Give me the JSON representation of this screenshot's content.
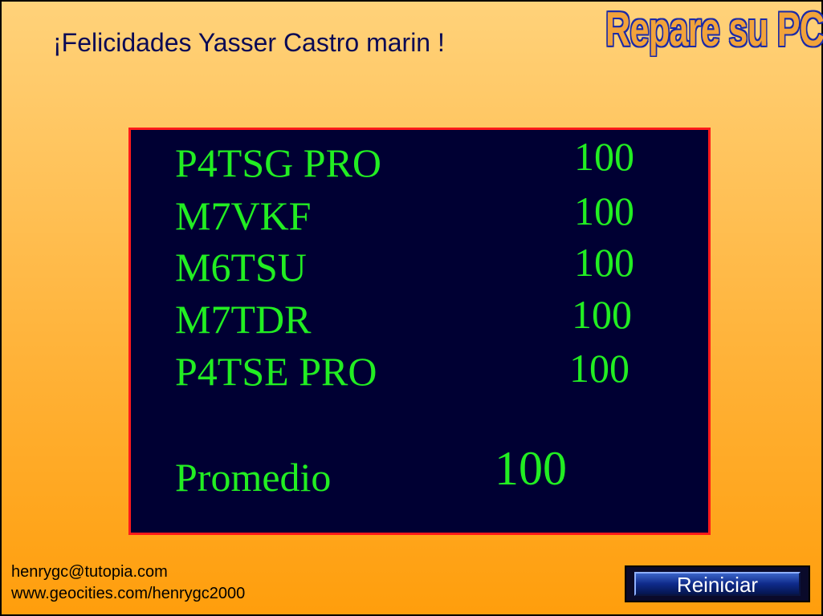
{
  "greeting": "¡Felicidades Yasser Castro marin !",
  "logo": "Repare su PC",
  "results": [
    {
      "label": "P4TSG PRO",
      "score": "100"
    },
    {
      "label": "M7VKF",
      "score": "100"
    },
    {
      "label": "M6TSU",
      "score": "100"
    },
    {
      "label": "M7TDR",
      "score": "100"
    },
    {
      "label": "P4TSE PRO",
      "score": "100"
    }
  ],
  "average": {
    "label": "Promedio",
    "score": "100"
  },
  "footer": {
    "email": "henrygc@tutopia.com",
    "website": "www.geocities.com/henrygc2000"
  },
  "restart_button": "Reiniciar",
  "colors": {
    "panel_bg": "#000033",
    "panel_border": "#ff1a1a",
    "text_green": "#22ee22",
    "logo_fill": "#f2a33a",
    "logo_outline": "#1a2aa8"
  }
}
